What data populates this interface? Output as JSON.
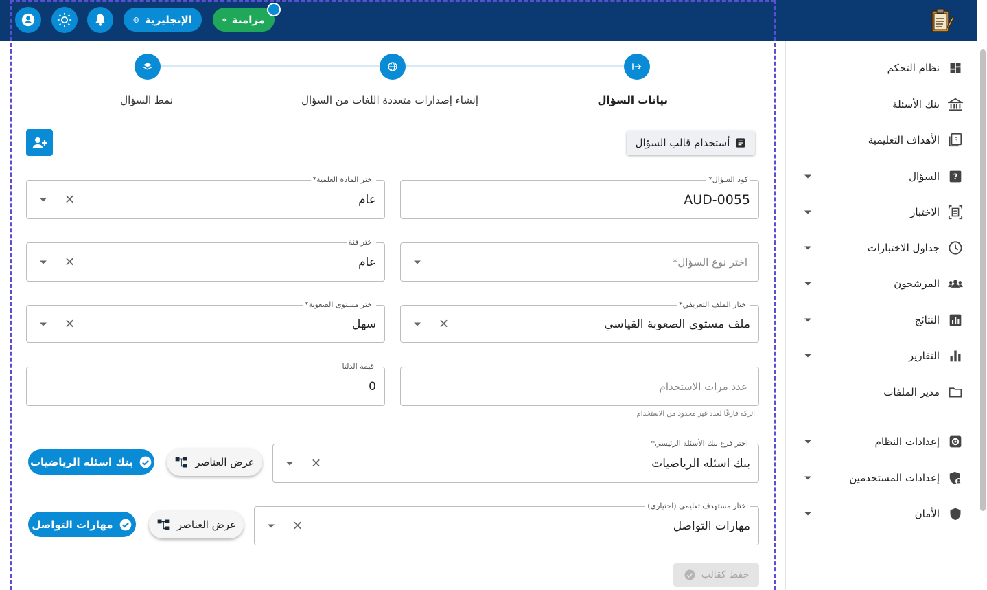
{
  "topbar": {
    "sync_label": "مزامنة",
    "language_label": "الإنجليزية",
    "icons": [
      "user-icon",
      "brightness-icon",
      "bell-icon",
      "globe-icon",
      "check-circle-icon"
    ],
    "colors": {
      "bar": "#0b3a72",
      "accent": "#0a8bd6",
      "sync": "#1fa85a"
    }
  },
  "stepper": {
    "steps": [
      {
        "label": "بيانات السؤال",
        "icon": "login-arrow-icon",
        "active": true
      },
      {
        "label": "إنشاء إصدارات متعددة اللغات من السؤال",
        "icon": "globe-icon",
        "active": false
      },
      {
        "label": "نمط السؤال",
        "icon": "layers-icon",
        "active": false
      }
    ]
  },
  "toolbar": {
    "template_label": "أستخدام قالب السؤال"
  },
  "form": {
    "code": {
      "label": "كود السؤال*",
      "value": "AUD-0055"
    },
    "subject": {
      "label": "اختر المادة العلمية*",
      "value": "عام"
    },
    "question_type": {
      "placeholder": "اختر نوع السؤال*"
    },
    "category": {
      "label": "اختر فئة",
      "value": "عام"
    },
    "profile": {
      "label": "اختار الملف التعريفي*",
      "value": "ملف مستوى الصعوبة القياسي"
    },
    "difficulty": {
      "label": "اختر مستوى الصعوبة*",
      "value": "سهل"
    },
    "usage": {
      "placeholder": "عدد مرات الاستخدام",
      "helper": "اتركه فارغًا لعدد غير محدود من الاستخدام"
    },
    "delta": {
      "label": "قيمة الدلتا",
      "value": "0"
    },
    "bank": {
      "label": "اختر فرع بنك الأسئلة الرئيسي*",
      "value": "بنك اسئله الرياضيات",
      "chip": "بنك اسئله الرياضيات"
    },
    "objective": {
      "label": "اختار مستهدف تعليمي (اختياري)",
      "value": "مهارات التواصل",
      "chip": "مهارات التواصل"
    },
    "show_elements_label": "عرض العناصر",
    "save_label": "حفظ كقالب"
  },
  "sidebar": {
    "items": [
      {
        "label": "نظام التحكم",
        "icon": "dashboard-icon",
        "expandable": false
      },
      {
        "label": "بنك الأسئلة",
        "icon": "bank-icon",
        "expandable": false
      },
      {
        "label": "الأهداف التعليمية",
        "icon": "book-icon",
        "expandable": false
      },
      {
        "label": "السؤال",
        "icon": "question-icon",
        "expandable": true
      },
      {
        "label": "الاختبار",
        "icon": "exam-icon",
        "expandable": true
      },
      {
        "label": "جداول الاختبارات",
        "icon": "clock-icon",
        "expandable": true
      },
      {
        "label": "المرشحون",
        "icon": "people-icon",
        "expandable": true
      },
      {
        "label": "النتائج",
        "icon": "results-icon",
        "expandable": true
      },
      {
        "label": "التقارير",
        "icon": "bar-chart-icon",
        "expandable": true
      },
      {
        "label": "مدير الملفات",
        "icon": "folder-icon",
        "expandable": false
      },
      {
        "label": "إعدادات النظام",
        "icon": "settings-icon",
        "expandable": true
      },
      {
        "label": "إعدادات المستخدمين",
        "icon": "user-shield-icon",
        "expandable": true
      },
      {
        "label": "الأمان",
        "icon": "shield-icon",
        "expandable": true
      }
    ]
  }
}
